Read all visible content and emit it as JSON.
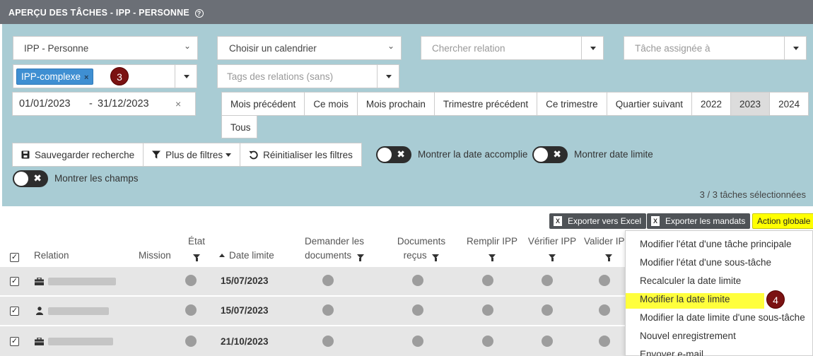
{
  "header": {
    "title": "APERÇU DES TÂCHES - IPP - PERSONNE",
    "help_icon": "question-circle-icon"
  },
  "filters": {
    "type_select": "IPP - Personne",
    "calendar_select": "Choisir un calendrier",
    "relation_search_placeholder": "Chercher relation",
    "assigned_task_placeholder": "Tâche assignée à",
    "tag": "IPP-complexe",
    "tag_remove": "×",
    "tags_relations_placeholder": "Tags des relations (sans)",
    "date_from": "01/01/2023",
    "date_sep": "-",
    "date_to": "31/12/2023",
    "date_clear": "×"
  },
  "period_buttons": [
    "Mois précédent",
    "Ce mois",
    "Mois prochain",
    "Trimestre précédent",
    "Ce trimestre",
    "Quartier suivant",
    "2022",
    "2023",
    "2024"
  ],
  "period_active": "2023",
  "tous_button": "Tous",
  "action_buttons": {
    "save": "Sauvegarder recherche",
    "more_filters": "Plus de filtres",
    "reset": "Réinitialiser les filtres"
  },
  "toggles": {
    "show_completed_date": "Montrer la date accomplie",
    "show_deadline": "Montrer date limite",
    "show_fields": "Montrer les champs"
  },
  "selection_count": "3 / 3 tâches sélectionnées",
  "toolbar": {
    "export_excel": "Exporter vers Excel",
    "export_mandates": "Exporter les mandats",
    "global_action": "Action globale"
  },
  "table": {
    "columns": {
      "relation": "Relation",
      "mission": "Mission",
      "etat": "État",
      "date_limite": "Date limite",
      "demander_docs_1": "Demander les",
      "demander_docs_2": "documents",
      "docs_recus_1": "Documents",
      "docs_recus_2": "reçus",
      "remplir_ipp": "Remplir IPP",
      "verifier_ipp": "Vérifier IPP",
      "valider_ipp": "Valider IP"
    },
    "rows": [
      {
        "date": "15/07/2023",
        "icon": "briefcase-icon"
      },
      {
        "date": "15/07/2023",
        "icon": "person-icon"
      },
      {
        "date": "21/10/2023",
        "icon": "briefcase-icon"
      }
    ]
  },
  "menu": {
    "items": [
      "Modifier l'état d'une tâche principale",
      "Modifier l'état d'une sous-tâche",
      "Recalculer la date limite",
      "Modifier la date limite",
      "Modifier la date limite d'une sous-tâche",
      "Nouvel enregistrement",
      "Envoyer e-mail"
    ],
    "highlighted": "Modifier la date limite"
  },
  "annotations": {
    "badge_3": "3",
    "badge_4": "4"
  },
  "colors": {
    "header_bg": "#6b6f76",
    "filter_panel_bg": "#a9ccd4",
    "tag_bg": "#3f8fd2",
    "highlight": "#ffff00",
    "badge": "#7b1212"
  }
}
